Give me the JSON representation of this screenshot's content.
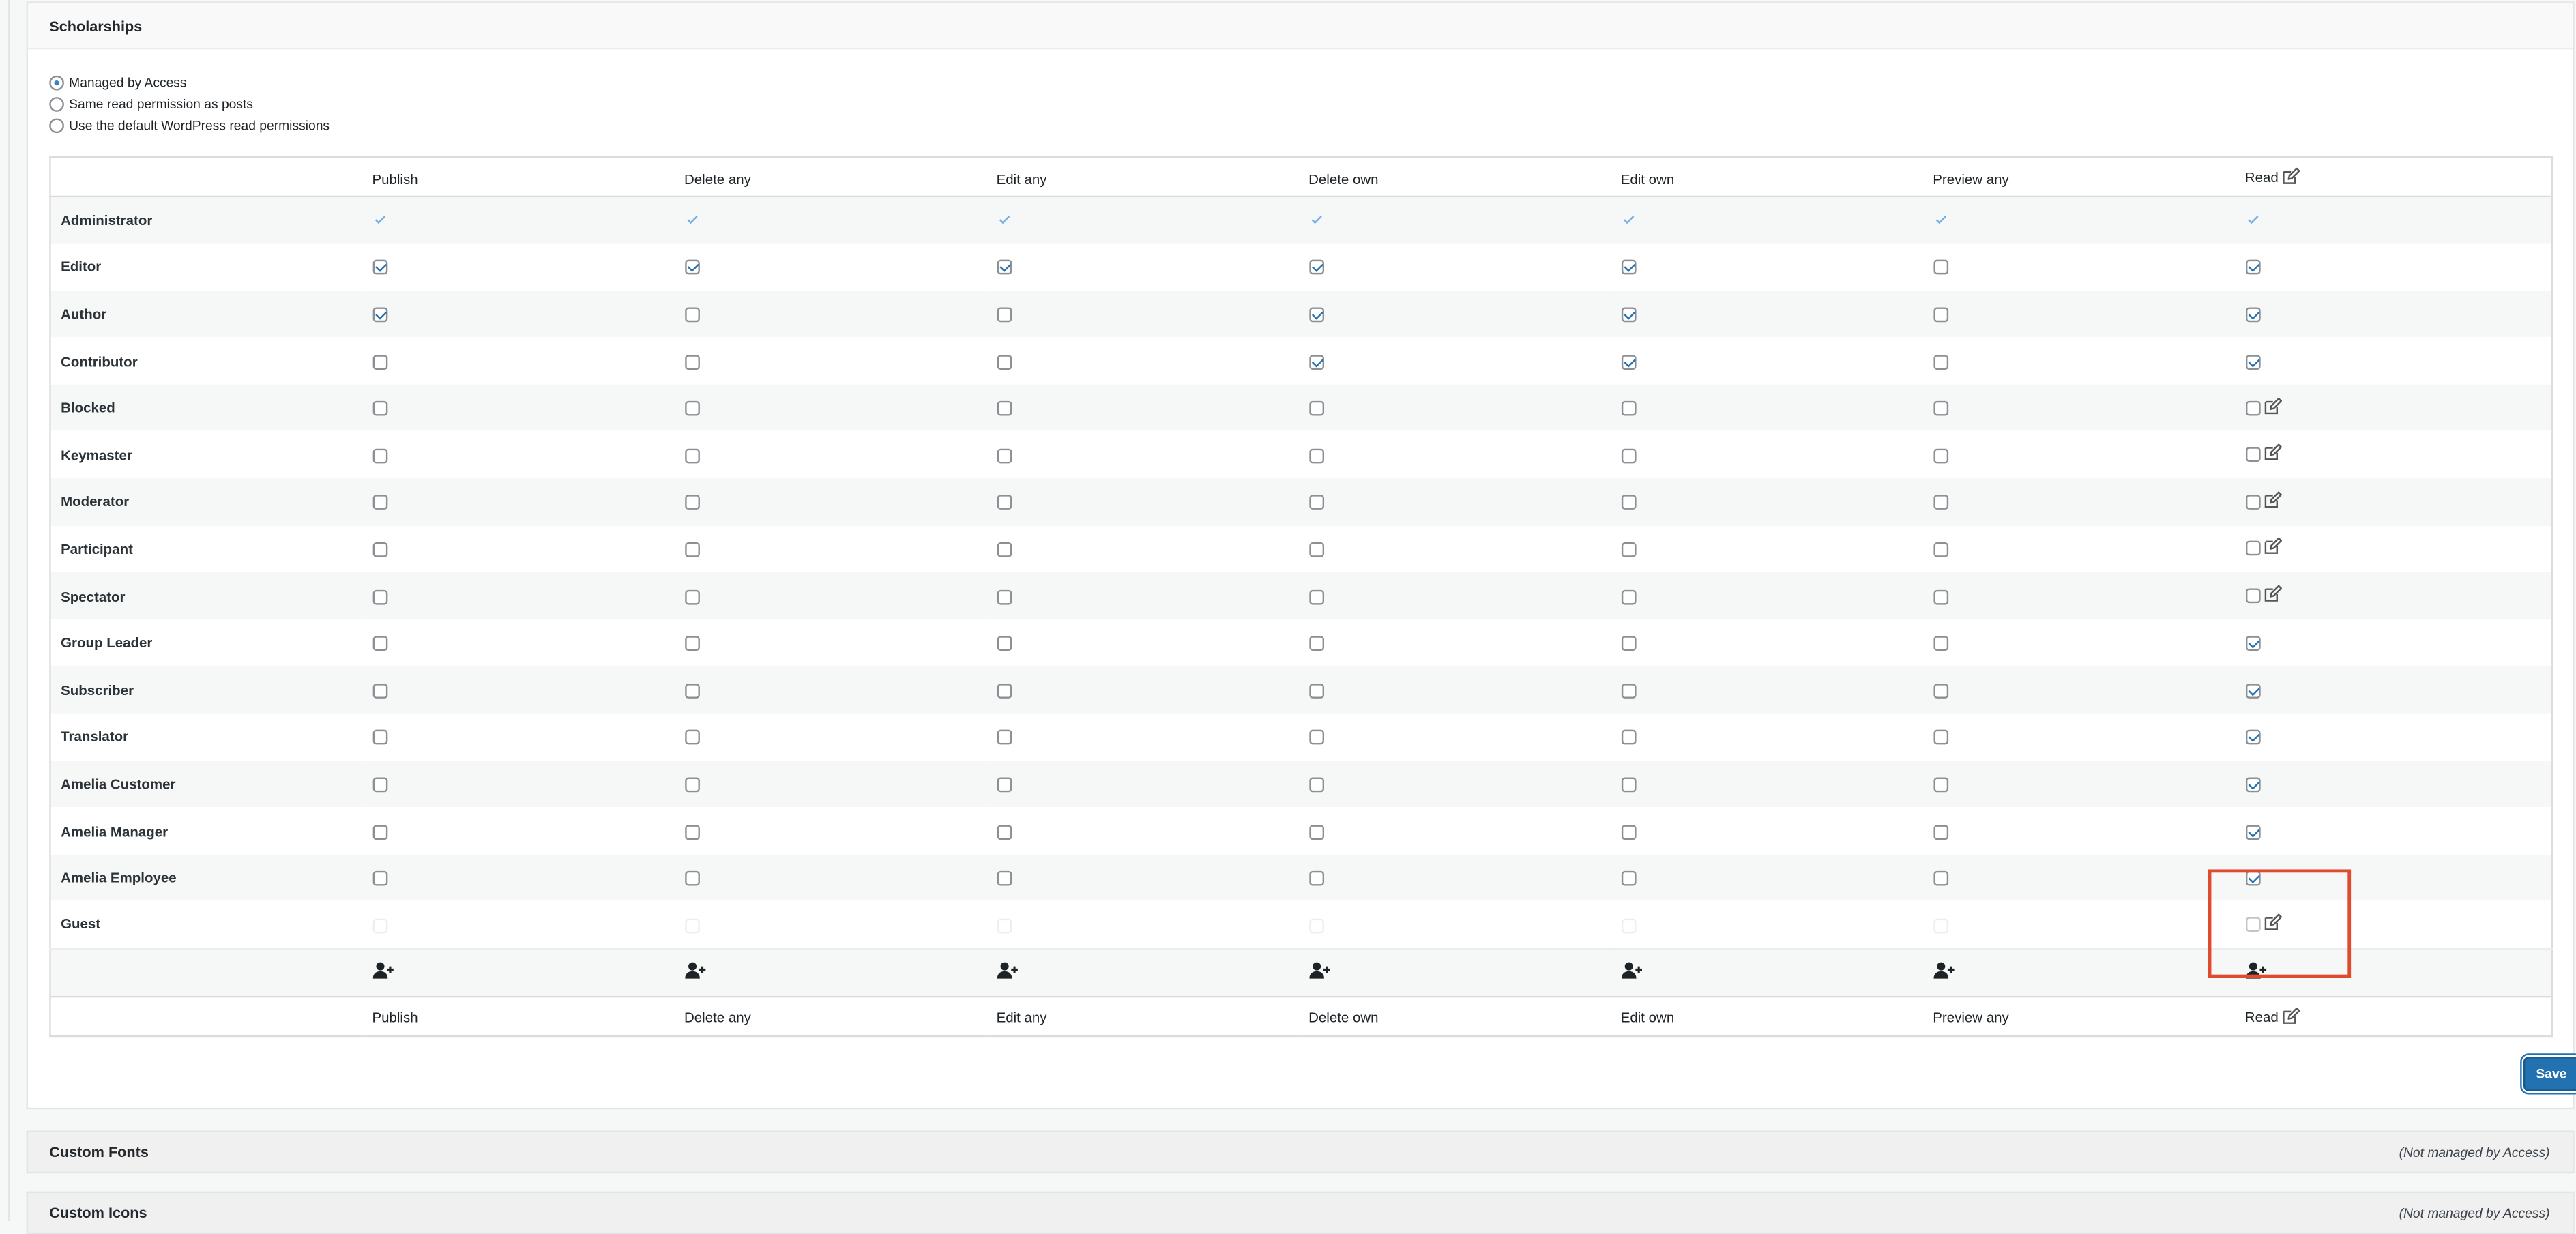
{
  "scholarships": {
    "title": "Scholarships",
    "options": [
      {
        "label": "Managed by Access",
        "selected": true
      },
      {
        "label": "Same read permission as posts",
        "selected": false
      },
      {
        "label": "Use the default WordPress read permissions",
        "selected": false
      }
    ],
    "columns": [
      "Publish",
      "Delete any",
      "Edit any",
      "Delete own",
      "Edit own",
      "Preview any",
      "Read"
    ],
    "roles": [
      {
        "name": "Administrator",
        "perms": [
          "fixed",
          "fixed",
          "fixed",
          "fixed",
          "fixed",
          "fixed",
          "fixed"
        ],
        "read_edit_icon": false
      },
      {
        "name": "Editor",
        "perms": [
          "checked",
          "checked",
          "checked",
          "checked",
          "checked",
          "empty",
          "checked"
        ],
        "read_edit_icon": false
      },
      {
        "name": "Author",
        "perms": [
          "checked",
          "empty",
          "empty",
          "checked",
          "checked",
          "empty",
          "checked"
        ],
        "read_edit_icon": false
      },
      {
        "name": "Contributor",
        "perms": [
          "empty",
          "empty",
          "empty",
          "checked",
          "checked",
          "empty",
          "checked"
        ],
        "read_edit_icon": false
      },
      {
        "name": "Blocked",
        "perms": [
          "empty",
          "empty",
          "empty",
          "empty",
          "empty",
          "empty",
          "empty"
        ],
        "read_edit_icon": true
      },
      {
        "name": "Keymaster",
        "perms": [
          "empty",
          "empty",
          "empty",
          "empty",
          "empty",
          "empty",
          "empty"
        ],
        "read_edit_icon": true
      },
      {
        "name": "Moderator",
        "perms": [
          "empty",
          "empty",
          "empty",
          "empty",
          "empty",
          "empty",
          "empty"
        ],
        "read_edit_icon": true
      },
      {
        "name": "Participant",
        "perms": [
          "empty",
          "empty",
          "empty",
          "empty",
          "empty",
          "empty",
          "empty"
        ],
        "read_edit_icon": true
      },
      {
        "name": "Spectator",
        "perms": [
          "empty",
          "empty",
          "empty",
          "empty",
          "empty",
          "empty",
          "empty"
        ],
        "read_edit_icon": true
      },
      {
        "name": "Group Leader",
        "perms": [
          "empty",
          "empty",
          "empty",
          "empty",
          "empty",
          "empty",
          "checked"
        ],
        "read_edit_icon": false
      },
      {
        "name": "Subscriber",
        "perms": [
          "empty",
          "empty",
          "empty",
          "empty",
          "empty",
          "empty",
          "checked"
        ],
        "read_edit_icon": false
      },
      {
        "name": "Translator",
        "perms": [
          "empty",
          "empty",
          "empty",
          "empty",
          "empty",
          "empty",
          "checked"
        ],
        "read_edit_icon": false
      },
      {
        "name": "Amelia Customer",
        "perms": [
          "empty",
          "empty",
          "empty",
          "empty",
          "empty",
          "empty",
          "checked"
        ],
        "read_edit_icon": false
      },
      {
        "name": "Amelia Manager",
        "perms": [
          "empty",
          "empty",
          "empty",
          "empty",
          "empty",
          "empty",
          "checked"
        ],
        "read_edit_icon": false
      },
      {
        "name": "Amelia Employee",
        "perms": [
          "empty",
          "empty",
          "empty",
          "empty",
          "empty",
          "empty",
          "checked"
        ],
        "read_edit_icon": false
      },
      {
        "name": "Guest",
        "perms": [
          "faint",
          "faint",
          "faint",
          "faint",
          "faint",
          "faint",
          "dim"
        ],
        "read_edit_icon": true
      }
    ],
    "save_label": "Save"
  },
  "sections": [
    {
      "title": "Custom Fonts",
      "note": "(Not managed by Access)"
    },
    {
      "title": "Custom Icons",
      "note": "(Not managed by Access)"
    }
  ],
  "colors": {
    "accent": "#2271b1",
    "highlight": "#e04a2f"
  },
  "icons": {
    "edit": "edit-icon",
    "add_user": "add-user-icon"
  }
}
